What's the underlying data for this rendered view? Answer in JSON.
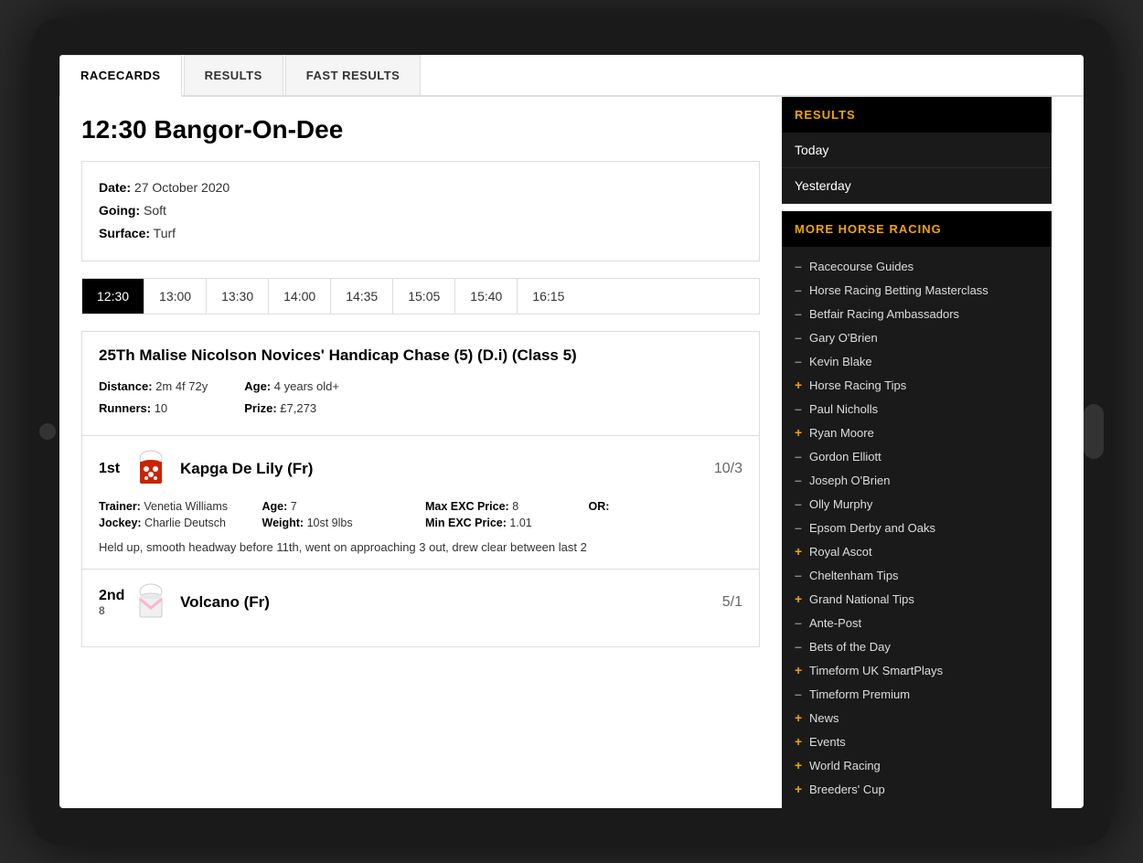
{
  "tabs": {
    "items": [
      {
        "label": "RACECARDS",
        "active": true
      },
      {
        "label": "RESULTS",
        "active": false
      },
      {
        "label": "FAST RESULTS",
        "active": false
      }
    ]
  },
  "page": {
    "title": "12:30 Bangor-On-Dee"
  },
  "race_info": {
    "date_label": "Date:",
    "date_value": "27 October 2020",
    "going_label": "Going:",
    "going_value": "Soft",
    "surface_label": "Surface:",
    "surface_value": "Turf"
  },
  "time_tabs": [
    "12:30",
    "13:00",
    "13:30",
    "14:00",
    "14:35",
    "15:05",
    "15:40",
    "16:15"
  ],
  "race": {
    "title": "25Th Malise Nicolson Novices' Handicap Chase (5) (D.i)",
    "class": "(Class 5)",
    "distance_label": "Distance:",
    "distance_value": "2m 4f 72y",
    "age_label": "Age:",
    "age_value": "4 years old+",
    "runners_label": "Runners:",
    "runners_value": "10",
    "prize_label": "Prize:",
    "prize_value": "£7,273"
  },
  "horses": [
    {
      "position": "1st",
      "name": "Kapga De Lily (Fr)",
      "odds": "10/3",
      "trainer_label": "Trainer:",
      "trainer_value": "Venetia Williams",
      "age_label": "Age:",
      "age_value": "7",
      "max_exc_label": "Max EXC Price:",
      "max_exc_value": "8",
      "or_label": "OR:",
      "or_value": "",
      "jockey_label": "Jockey:",
      "jockey_value": "Charlie Deutsch",
      "weight_label": "Weight:",
      "weight_value": "10st 9lbs",
      "min_exc_label": "Min EXC Price:",
      "min_exc_value": "1.01",
      "comment": "Held up, smooth headway before 11th, went on approaching 3 out, drew clear between last 2"
    },
    {
      "position": "2nd",
      "sub_position": "8",
      "name": "Volcano (Fr)",
      "odds": "5/1"
    }
  ],
  "sidebar": {
    "results_header": "RESULTS",
    "results_items": [
      "Today",
      "Yesterday"
    ],
    "more_header": "MORE HORSE RACING",
    "links": [
      {
        "label": "Racecourse Guides",
        "bullet_type": "gray"
      },
      {
        "label": "Horse Racing Betting Masterclass",
        "bullet_type": "gray"
      },
      {
        "label": "Betfair Racing Ambassadors",
        "bullet_type": "gray"
      },
      {
        "label": "Gary O'Brien",
        "bullet_type": "gray"
      },
      {
        "label": "Kevin Blake",
        "bullet_type": "gray"
      },
      {
        "label": "Horse Racing Tips",
        "bullet_type": "yellow"
      },
      {
        "label": "Paul Nicholls",
        "bullet_type": "gray"
      },
      {
        "label": "Ryan Moore",
        "bullet_type": "yellow"
      },
      {
        "label": "Gordon Elliott",
        "bullet_type": "gray"
      },
      {
        "label": "Joseph O'Brien",
        "bullet_type": "gray"
      },
      {
        "label": "Olly Murphy",
        "bullet_type": "gray"
      },
      {
        "label": "Epsom Derby and Oaks",
        "bullet_type": "gray"
      },
      {
        "label": "Royal Ascot",
        "bullet_type": "yellow"
      },
      {
        "label": "Cheltenham Tips",
        "bullet_type": "gray"
      },
      {
        "label": "Grand National Tips",
        "bullet_type": "yellow"
      },
      {
        "label": "Ante-Post",
        "bullet_type": "gray"
      },
      {
        "label": "Bets of the Day",
        "bullet_type": "gray"
      },
      {
        "label": "Timeform UK SmartPlays",
        "bullet_type": "yellow"
      },
      {
        "label": "Timeform Premium",
        "bullet_type": "gray"
      },
      {
        "label": "News",
        "bullet_type": "yellow"
      },
      {
        "label": "Events",
        "bullet_type": "yellow"
      },
      {
        "label": "World Racing",
        "bullet_type": "yellow"
      },
      {
        "label": "Breeders' Cup",
        "bullet_type": "yellow"
      }
    ]
  }
}
